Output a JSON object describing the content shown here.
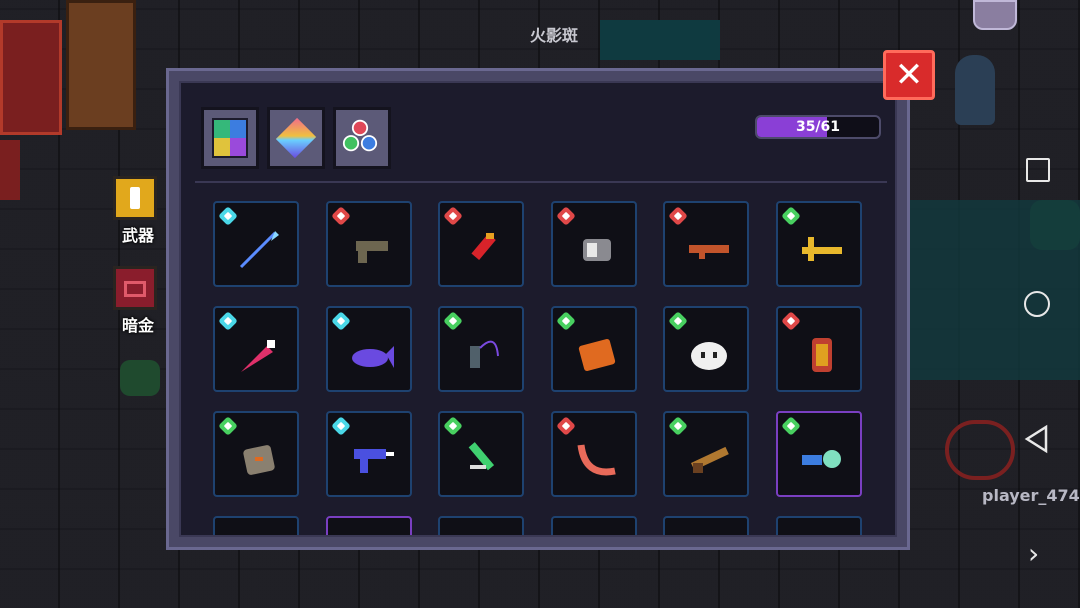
{
  "scene": {
    "player_name": "火影斑",
    "other_player": "player_474"
  },
  "side_tabs": [
    {
      "label": "武器"
    },
    {
      "label": "暗金"
    }
  ],
  "panel": {
    "close_label": "✕",
    "progress_text": "35/61",
    "progress_fraction": 0.574,
    "filters": [
      "filter-all-icon",
      "filter-rarity-icon",
      "filter-color-icon"
    ]
  },
  "items": [
    {
      "name": "spear",
      "gem": "blue",
      "color": "#5a8cff"
    },
    {
      "name": "pistol",
      "gem": "red",
      "color": "#6d6650"
    },
    {
      "name": "red-dagger",
      "gem": "red",
      "color": "#d8232a"
    },
    {
      "name": "glove",
      "gem": "red",
      "color": "#8a8a90"
    },
    {
      "name": "rifle",
      "gem": "red",
      "color": "#c2542b"
    },
    {
      "name": "golden-key",
      "gem": "green",
      "color": "#e8b82c"
    },
    {
      "name": "pink-drill",
      "gem": "blue",
      "color": "#e0306a"
    },
    {
      "name": "purple-fish",
      "gem": "blue",
      "color": "#6a4ae0"
    },
    {
      "name": "whip",
      "gem": "green",
      "color": "#50606a"
    },
    {
      "name": "orange-brick",
      "gem": "green",
      "color": "#e06a20"
    },
    {
      "name": "white-blob",
      "gem": "green",
      "color": "#f0f0f0"
    },
    {
      "name": "lantern",
      "gem": "red",
      "color": "#e0a020"
    },
    {
      "name": "stone-golem",
      "gem": "green",
      "color": "#8a8070"
    },
    {
      "name": "uzi",
      "gem": "blue",
      "color": "#4a50e0"
    },
    {
      "name": "green-sword",
      "gem": "green",
      "color": "#40d070"
    },
    {
      "name": "boomerang",
      "gem": "red",
      "color": "#e86a5a"
    },
    {
      "name": "shotgun",
      "gem": "green",
      "color": "#b07830"
    },
    {
      "name": "bubble-gun",
      "gem": "green",
      "color": "#80e0c0"
    }
  ]
}
